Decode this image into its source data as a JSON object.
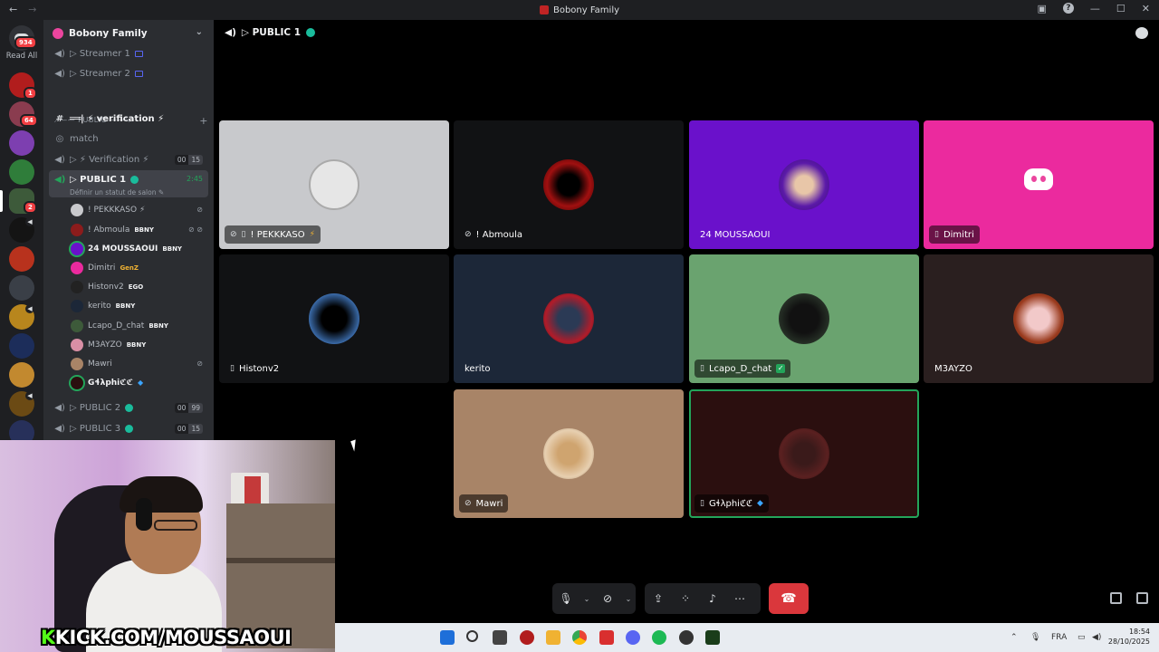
{
  "window": {
    "title": "Bobony Family"
  },
  "rail": {
    "home_badge": "934",
    "read_all": "Read All",
    "badges": [
      "1",
      "64",
      "2"
    ]
  },
  "sidebar": {
    "server_name": "Bobony Family",
    "channels_top": [
      {
        "name": "▷ Streamer 1"
      },
      {
        "name": "▷ Streamer 2"
      }
    ],
    "category": "⟋—— PUBLIC ——⟍",
    "verification_text": "══| ⚡ verification ⚡",
    "match": "match",
    "voice_verification": {
      "name": "▷ ⚡ Verification ⚡",
      "count_a": "00",
      "count_b": "15"
    },
    "public1": {
      "name": "▷ PUBLIC 1",
      "time": "2:45",
      "status": "Définir un statut de salon"
    },
    "public2": {
      "name": "▷ PUBLIC 2",
      "count_a": "00",
      "count_b": "99"
    },
    "public3": {
      "name": "▷ PUBLIC 3",
      "count_a": "00",
      "count_b": "15"
    },
    "voice_users": [
      {
        "name": "! PEKKKASO ⚡",
        "tag": ""
      },
      {
        "name": "! Abmoula",
        "tag": "BBNY"
      },
      {
        "name": "24 MOUSSAOUI",
        "tag": "BBNY"
      },
      {
        "name": "Dimitri",
        "tag": "GenZ"
      },
      {
        "name": "Histonv2",
        "tag": "EGO"
      },
      {
        "name": "kerito",
        "tag": "BBNY"
      },
      {
        "name": "Lcapo_D_chat",
        "tag": "BBNY"
      },
      {
        "name": "M3AYZO",
        "tag": "BBNY"
      },
      {
        "name": "Mawri",
        "tag": ""
      },
      {
        "name": "Gɬλphiℭℭ",
        "tag": ""
      }
    ]
  },
  "stage": {
    "channel_title": "▷ PUBLIC 1",
    "tiles": [
      {
        "name": "! PEKKKASO",
        "bg": "#c8c9cc"
      },
      {
        "name": "! Abmoula",
        "bg": "#111214"
      },
      {
        "name": "24 MOUSSAOUI",
        "bg": "#6a11cb"
      },
      {
        "name": "Dimitri",
        "bg": "#eb2a9e"
      },
      {
        "name": "Histonv2",
        "bg": "#111214"
      },
      {
        "name": "kerito",
        "bg": "#1c2738"
      },
      {
        "name": "Lcapo_D_chat",
        "bg": "#6aa36f"
      },
      {
        "name": "M3AYZO",
        "bg": "#2a1f1f"
      },
      {
        "name": "Mawri",
        "bg": "#a88467"
      },
      {
        "name": "Gɬλphiℭℭ",
        "bg": "#2b0f0f"
      }
    ]
  },
  "webcam": {
    "overlay_text_k": "K",
    "overlay_text": "KICK.COM/MOUSSAOUI"
  },
  "taskbar": {
    "lang": "FRA",
    "time": "18:54",
    "date": "28/10/2025"
  }
}
